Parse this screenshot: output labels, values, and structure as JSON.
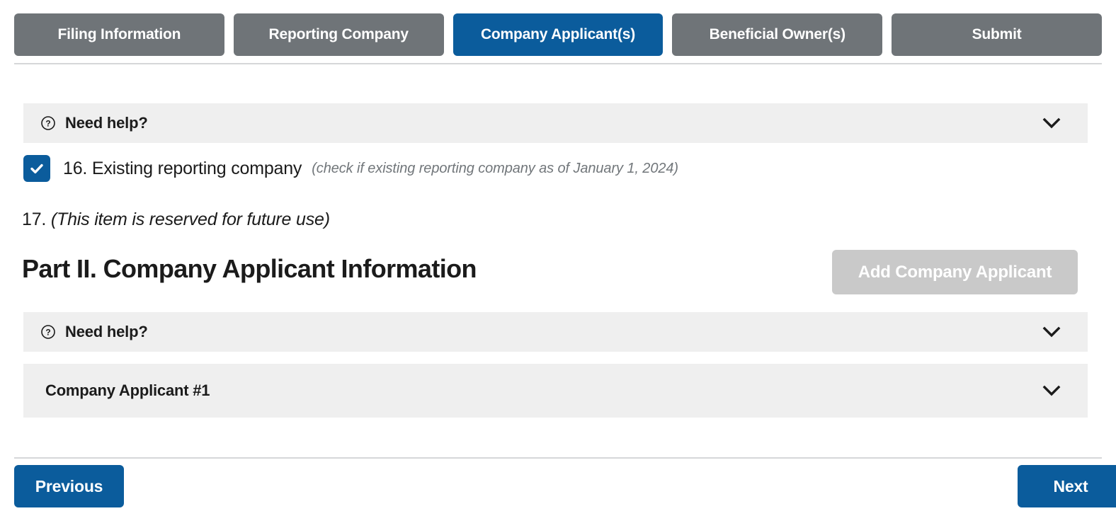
{
  "tabs": [
    {
      "label": "Filing Information",
      "active": false
    },
    {
      "label": "Reporting Company",
      "active": false
    },
    {
      "label": "Company Applicant(s)",
      "active": true
    },
    {
      "label": "Beneficial Owner(s)",
      "active": false
    },
    {
      "label": "Submit",
      "active": false
    }
  ],
  "help_bar_top": {
    "label": "Need help?",
    "icon": "question-circle-icon",
    "chevron": "chevron-down-icon"
  },
  "item16": {
    "checked": true,
    "number_and_label": "16. Existing reporting company",
    "hint": "(check if existing reporting company as of January 1, 2024)"
  },
  "item17": {
    "number": "17.",
    "text": "(This item is reserved for future use)"
  },
  "part2": {
    "heading": "Part II. Company Applicant Information",
    "add_button_label": "Add Company Applicant",
    "add_button_disabled": true
  },
  "help_bar_part2": {
    "label": "Need help?",
    "icon": "question-circle-icon",
    "chevron": "chevron-down-icon"
  },
  "applicant_section": {
    "label": "Company Applicant #1",
    "chevron": "chevron-down-icon"
  },
  "footer": {
    "previous_label": "Previous",
    "next_label": "Next"
  },
  "colors": {
    "accent_blue": "#0b5c9c",
    "tab_gray": "#6f7478",
    "bar_gray": "#efefef",
    "disabled_gray": "#c9c9c9",
    "hint_gray": "#71767a",
    "rule_gray": "#d6d7d9"
  }
}
